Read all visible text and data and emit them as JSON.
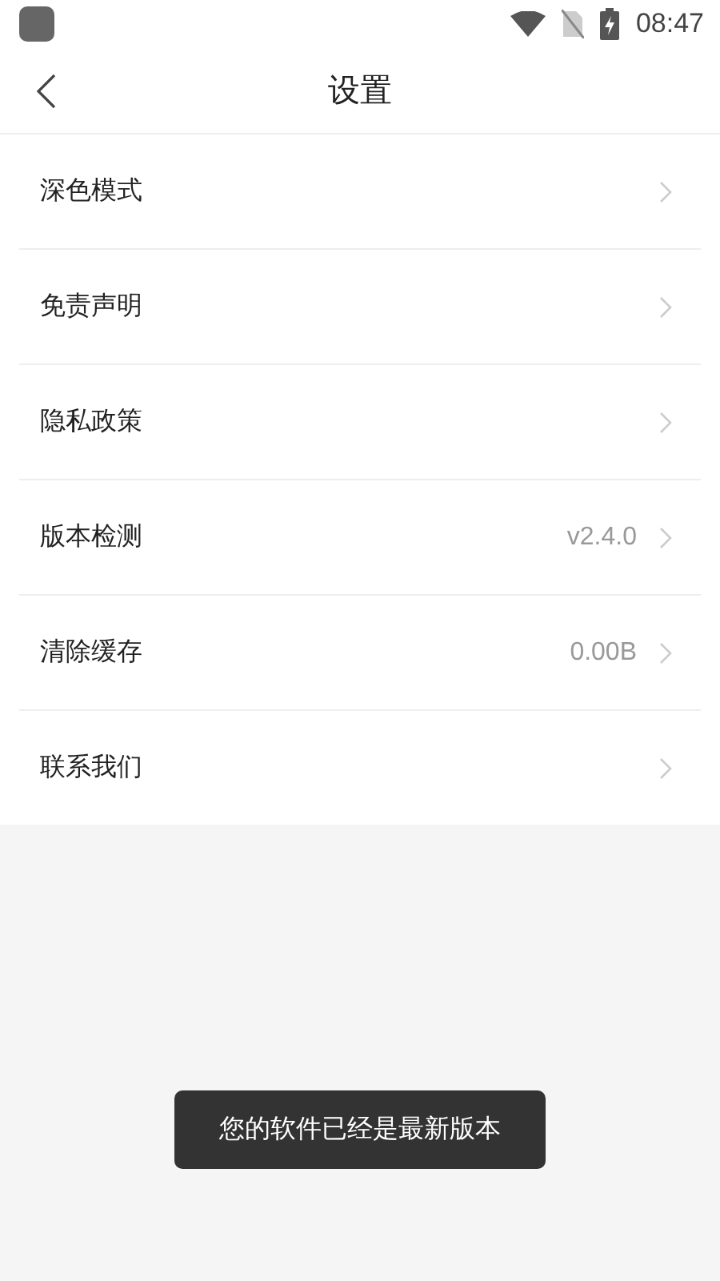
{
  "status_bar": {
    "time": "08:47"
  },
  "header": {
    "title": "设置"
  },
  "settings": [
    {
      "label": "深色模式"
    },
    {
      "label": "免责声明"
    },
    {
      "label": "隐私政策"
    },
    {
      "label": "版本检测",
      "value": "v2.4.0"
    },
    {
      "label": "清除缓存",
      "value": "0.00B"
    },
    {
      "label": "联系我们"
    }
  ],
  "toast": {
    "text": "您的软件已经是最新版本"
  }
}
